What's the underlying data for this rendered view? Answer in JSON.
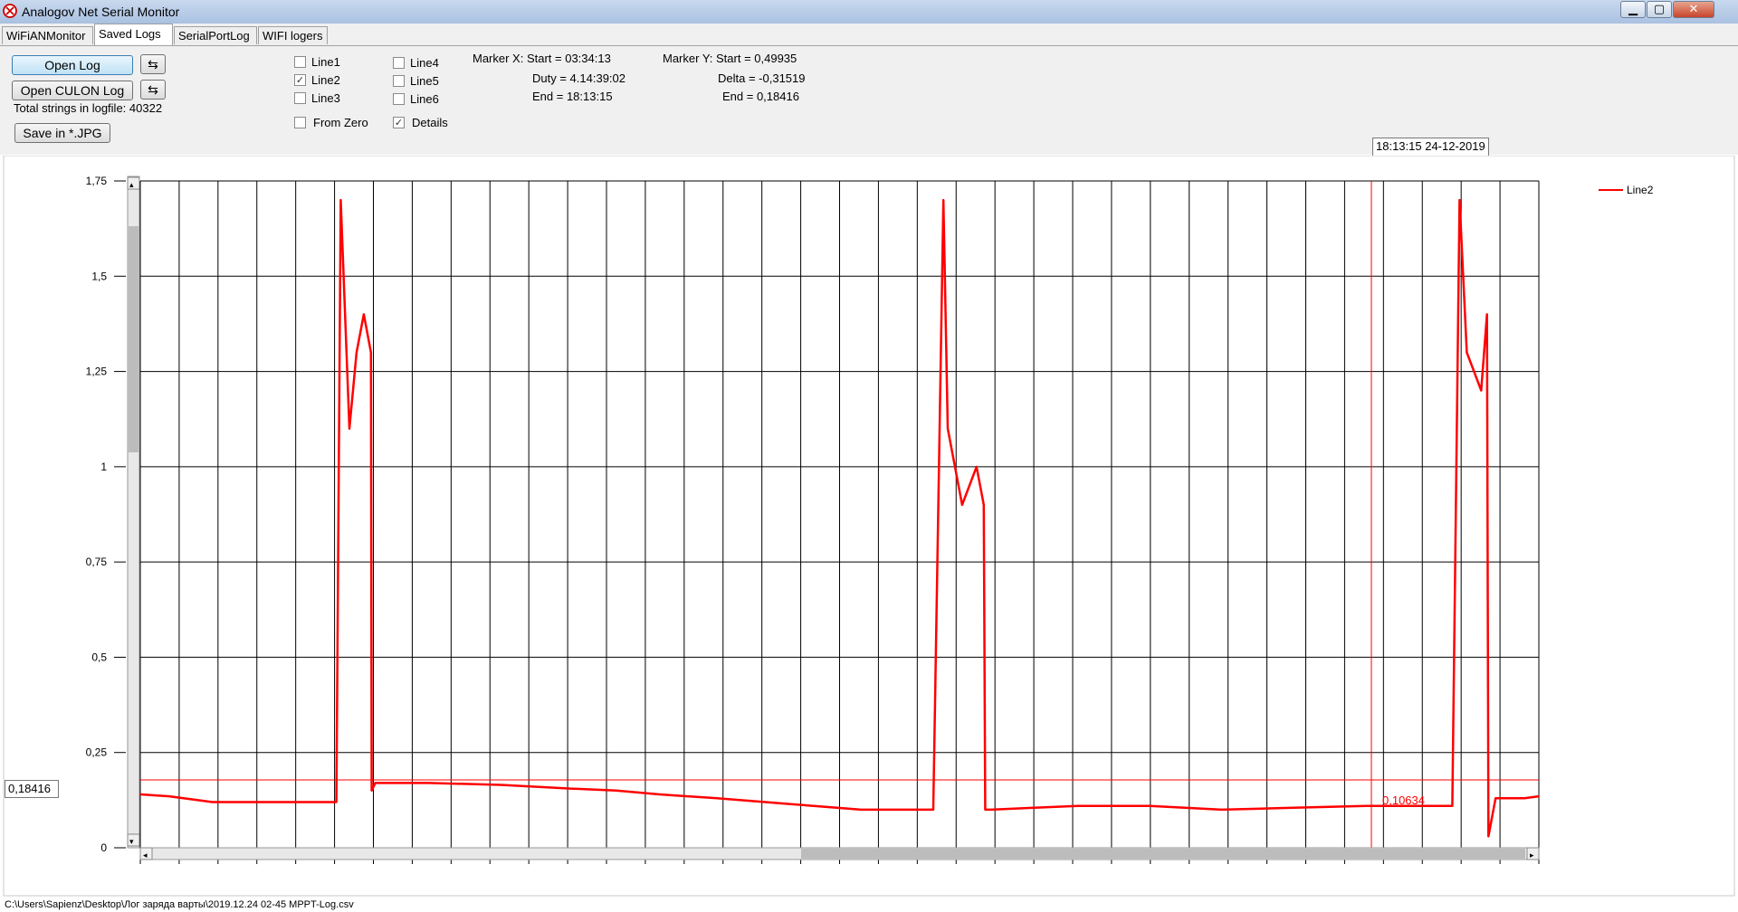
{
  "window": {
    "title": "Analogov Net Serial Monitor",
    "controls": {
      "minimize": "▁",
      "maximize": "▢",
      "close": "✕"
    }
  },
  "tabs": [
    {
      "label": "WiFiANMonitor"
    },
    {
      "label": "Saved Logs"
    },
    {
      "label": "SerialPortLog"
    },
    {
      "label": "WIFI logers"
    }
  ],
  "toolbar": {
    "open_log": "Open Log",
    "open_culon_log": "Open CULON Log",
    "save_jpg": "Save in *.JPG",
    "refresh_icon": "⇆",
    "total_strings": "Total strings in logfile: 40322"
  },
  "checkboxes": [
    {
      "label": "Line1",
      "checked": false
    },
    {
      "label": "Line2",
      "checked": true
    },
    {
      "label": "Line3",
      "checked": false
    },
    {
      "label": "Line4",
      "checked": false
    },
    {
      "label": "Line5",
      "checked": false
    },
    {
      "label": "Line6",
      "checked": false
    },
    {
      "label": "From Zero",
      "checked": false
    },
    {
      "label": "Details",
      "checked": true
    }
  ],
  "check_mark": "✓",
  "marker_x": {
    "start": "Marker X: Start = 03:34:13",
    "duty": "Duty = 4.14:39:02",
    "end": "End  = 18:13:15"
  },
  "marker_y": {
    "start": "Marker Y: Start = 0,49935",
    "delta": "Delta = -0,31519",
    "end": "End  = 0,18416"
  },
  "date_label": "18:13:15 24-12-2019",
  "y_value_box": "0,18416",
  "status_path": "C:\\Users\\Sapienz\\Desktop\\Лог заряда варты\\2019.12.24 02-45 MPPT-Log.csv",
  "colors": {
    "series": "#ff0000",
    "grid": "#000000"
  },
  "chart_data": {
    "type": "line",
    "ylim": [
      0,
      1.75
    ],
    "yticks": [
      "1,75",
      "1,5",
      "1,25",
      "1",
      "0,75",
      "0,5",
      "0,25",
      "0"
    ],
    "grid": true,
    "legend": "top-right",
    "series": [
      {
        "name": "Line2",
        "color": "#ff0000",
        "x": [
          0,
          2,
          5,
          8,
          10,
          12,
          13.6,
          13.9,
          14.5,
          15.0,
          15.5,
          16.0,
          16.05,
          16.3,
          17,
          20,
          25,
          30,
          33,
          36,
          40,
          45,
          50,
          55,
          55.7,
          56,
          57,
          58,
          58.5,
          58.6,
          59,
          62,
          65,
          70,
          75,
          80,
          85,
          90,
          91,
          91.5,
          92,
          93,
          93.4,
          93.5,
          94,
          96,
          97
        ],
        "values": [
          0.14,
          0.135,
          0.12,
          0.12,
          0.12,
          0.12,
          0.12,
          1.7,
          1.1,
          1.3,
          1.4,
          1.3,
          0.15,
          0.17,
          0.17,
          0.17,
          0.165,
          0.155,
          0.15,
          0.14,
          0.13,
          0.115,
          0.1,
          0.1,
          1.7,
          1.1,
          0.9,
          1.0,
          0.9,
          0.1,
          0.1,
          0.105,
          0.11,
          0.11,
          0.1,
          0.105,
          0.11,
          0.11,
          0.11,
          1.7,
          1.3,
          1.2,
          1.4,
          0.03,
          0.13,
          0.13,
          0.135
        ]
      }
    ],
    "annotations": [
      {
        "text": "0,10634",
        "y": 0.10634
      }
    ],
    "markers": {
      "y_start": 0.49935,
      "y_end": 0.18416
    }
  }
}
